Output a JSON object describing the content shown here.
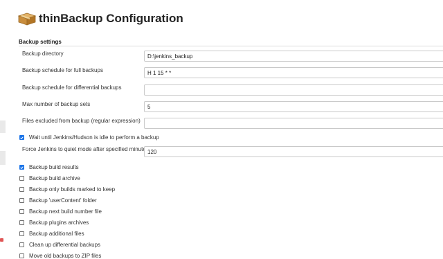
{
  "header": {
    "title": "thinBackup Configuration",
    "icon": "package-box-icon"
  },
  "section": {
    "title": "Backup settings"
  },
  "fields": {
    "backup_directory": {
      "label": "Backup directory",
      "value": "D:\\jenkins_backup"
    },
    "full_schedule": {
      "label": "Backup schedule for full backups",
      "value": "H 1 15 * *"
    },
    "diff_schedule": {
      "label": "Backup schedule for differential backups",
      "value": ""
    },
    "max_sets": {
      "label": "Max number of backup sets",
      "value": "5"
    },
    "excluded_files": {
      "label": "Files excluded from backup (regular expression)",
      "value": ""
    },
    "quiet_mode_timeout": {
      "label": "Force Jenkins to quiet mode after specified minutes",
      "value": "120"
    }
  },
  "checkboxes": {
    "wait_idle": {
      "label": "Wait until Jenkins/Hudson is idle to perform a backup",
      "checked": true
    },
    "build_results": {
      "label": "Backup build results",
      "checked": true
    },
    "build_archive": {
      "label": "Backup build archive",
      "checked": false
    },
    "builds_keep": {
      "label": "Backup only builds marked to keep",
      "checked": false
    },
    "user_content": {
      "label": "Backup 'userContent' folder",
      "checked": false
    },
    "next_build_number": {
      "label": "Backup next build number file",
      "checked": false
    },
    "plugins_archives": {
      "label": "Backup plugins archives",
      "checked": false
    },
    "additional_files": {
      "label": "Backup additional files",
      "checked": false
    },
    "cleanup_diff": {
      "label": "Clean up differential backups",
      "checked": false
    },
    "move_old_zip": {
      "label": "Move old backups to ZIP files",
      "checked": false
    }
  },
  "colors": {
    "accent": "#1a73e8",
    "text": "#333333",
    "border": "#c9c9c9"
  }
}
